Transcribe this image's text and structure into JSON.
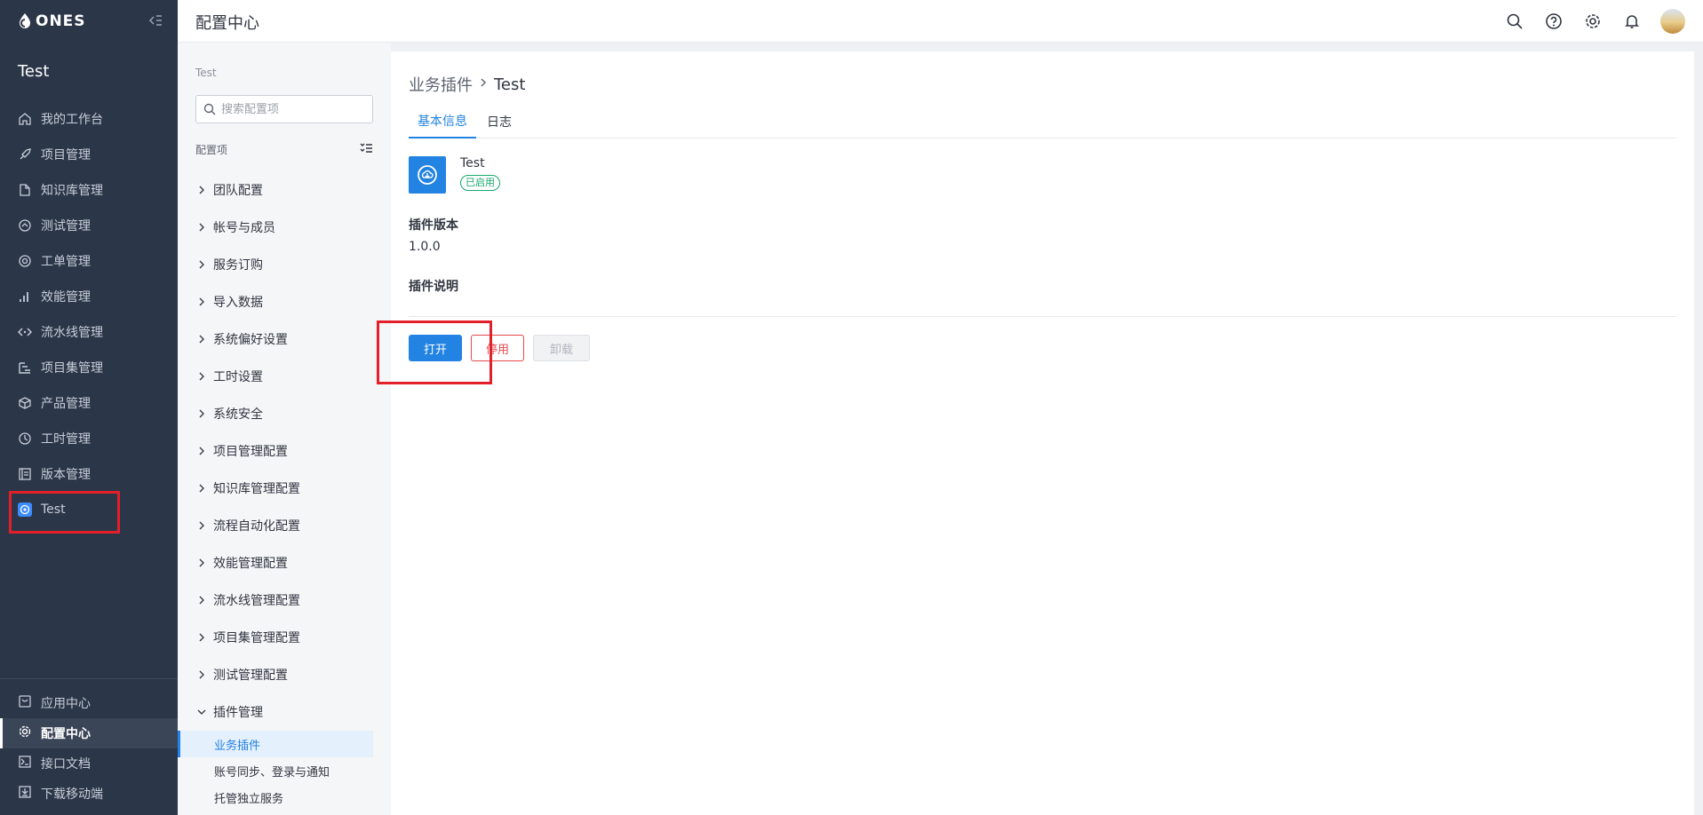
{
  "app": {
    "logo_text": "ONES",
    "org_name": "Test"
  },
  "sidebar": {
    "items": [
      {
        "label": "我的工作台",
        "icon": "home-icon"
      },
      {
        "label": "项目管理",
        "icon": "rocket-icon"
      },
      {
        "label": "知识库管理",
        "icon": "document-icon"
      },
      {
        "label": "测试管理",
        "icon": "test-icon"
      },
      {
        "label": "工单管理",
        "icon": "target-icon"
      },
      {
        "label": "效能管理",
        "icon": "bar-chart-icon"
      },
      {
        "label": "流水线管理",
        "icon": "code-icon"
      },
      {
        "label": "项目集管理",
        "icon": "program-icon"
      },
      {
        "label": "产品管理",
        "icon": "box-icon"
      },
      {
        "label": "工时管理",
        "icon": "clock-icon"
      },
      {
        "label": "版本管理",
        "icon": "version-icon"
      },
      {
        "label": "Test",
        "icon": "plugin-app-icon"
      }
    ],
    "bottom_items": [
      {
        "label": "应用中心",
        "icon": "app-center-icon"
      },
      {
        "label": "配置中心",
        "icon": "gear-icon",
        "active": true
      },
      {
        "label": "接口文档",
        "icon": "terminal-icon"
      },
      {
        "label": "下载移动端",
        "icon": "download-icon"
      }
    ]
  },
  "header": {
    "title": "配置中心"
  },
  "config": {
    "crumb": "Test",
    "search_placeholder": "搜索配置项",
    "section_label": "配置项",
    "items": [
      "团队配置",
      "帐号与成员",
      "服务订购",
      "导入数据",
      "系统偏好设置",
      "工时设置",
      "系统安全",
      "项目管理配置",
      "知识库管理配置",
      "流程自动化配置",
      "效能管理配置",
      "流水线管理配置",
      "项目集管理配置",
      "测试管理配置"
    ],
    "expanded_item": "插件管理",
    "sub_items": [
      "业务插件",
      "账号同步、登录与通知",
      "托管独立服务"
    ]
  },
  "main": {
    "breadcrumb_parent": "业务插件",
    "breadcrumb_current": "Test",
    "tabs": [
      "基本信息",
      "日志"
    ],
    "plugin": {
      "name": "Test",
      "status": "已启用",
      "version_label": "插件版本",
      "version": "1.0.0",
      "desc_label": "插件说明"
    },
    "buttons": {
      "open": "打开",
      "disable": "停用",
      "uninstall": "卸载"
    }
  },
  "colors": {
    "sidebar_bg": "#2b3648",
    "accent": "#2383e2",
    "danger": "#e5484d",
    "success": "#18a86b",
    "annotation": "#e3202a"
  }
}
